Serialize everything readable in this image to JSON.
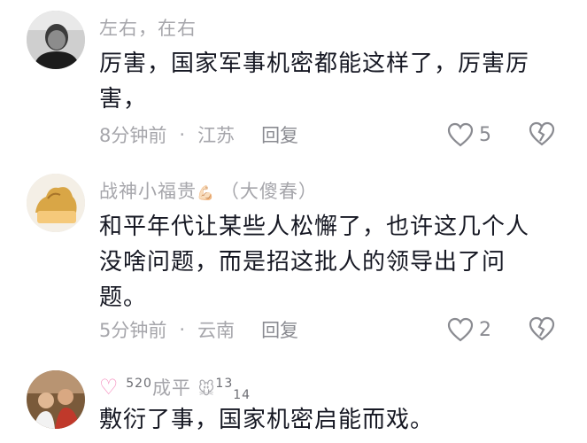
{
  "comments": [
    {
      "username": "左右，在右",
      "text": "厉害，国家军事机密都能这样了，厉害厉害，",
      "time": "8分钟前",
      "location": "江苏",
      "reply_label": "回复",
      "likes": "5"
    },
    {
      "username": "战神小福贵",
      "username_badge": "💪🏻",
      "username_suffix": "（大傻春）",
      "text": "和平年代让某些人松懈了，也许这几个人没啥问题，而是招这批人的领导出了问题。",
      "time": "5分钟前",
      "location": "云南",
      "reply_label": "回复",
      "likes": "2"
    },
    {
      "username_prefix_a": "520",
      "username": "成平",
      "username_suffix_a": "13",
      "username_suffix_b": "14",
      "text": "敷衍了事，国家机密启能而戏。"
    }
  ],
  "colors": {
    "muted": "#a6a6ab",
    "text": "#161823",
    "icon": "#8a8b91"
  },
  "icons": [
    "heart-outline-icon",
    "broken-heart-icon",
    "pink-heart-icon",
    "mouse-emoji-icon"
  ]
}
